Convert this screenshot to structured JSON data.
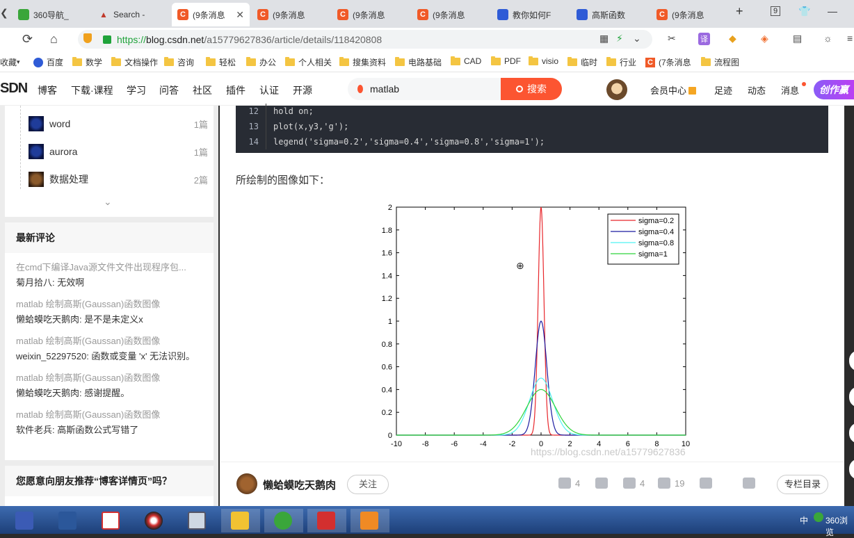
{
  "browser": {
    "tabs": [
      {
        "label": "360导航_",
        "icon": "360-icon"
      },
      {
        "label": "Search -",
        "icon": "matlab-icon"
      },
      {
        "label": "(9条消息",
        "icon": "csdn-icon",
        "active": true
      },
      {
        "label": "(9条消息",
        "icon": "csdn-icon"
      },
      {
        "label": "(9条消息",
        "icon": "csdn-icon"
      },
      {
        "label": "(9条消息",
        "icon": "csdn-icon"
      },
      {
        "label": "教你如何F",
        "icon": "baidu-paw-icon"
      },
      {
        "label": "高斯函数",
        "icon": "baidu-paw-icon"
      },
      {
        "label": "(9条消息",
        "icon": "csdn-icon"
      }
    ],
    "tab_close": "✕",
    "new_tab": "+",
    "tab_count": "9",
    "minimize": "—",
    "url": {
      "scheme": "https://",
      "host": "blog.csdn.net",
      "path": "/a15779627836/article/details/118420808"
    },
    "translate_badge": "译",
    "bookmarks": [
      {
        "label": "收藏",
        "type": "text"
      },
      {
        "label": "百度",
        "type": "baidu"
      },
      {
        "label": "数学",
        "type": "folder"
      },
      {
        "label": "文档操作",
        "type": "folder"
      },
      {
        "label": "咨询",
        "type": "folder"
      },
      {
        "label": "轻松",
        "type": "folder"
      },
      {
        "label": "办公",
        "type": "folder"
      },
      {
        "label": "个人相关",
        "type": "folder"
      },
      {
        "label": "搜集资料",
        "type": "folder"
      },
      {
        "label": "电路基础",
        "type": "folder"
      },
      {
        "label": "CAD",
        "type": "folder"
      },
      {
        "label": "PDF",
        "type": "folder"
      },
      {
        "label": "visio",
        "type": "folder"
      },
      {
        "label": "临时",
        "type": "folder"
      },
      {
        "label": "行业",
        "type": "folder"
      },
      {
        "label": "(7条消息",
        "type": "csdn"
      },
      {
        "label": "流程图",
        "type": "folder"
      }
    ]
  },
  "csdn": {
    "logo": "SDN",
    "nav": [
      "博客",
      "下载·课程",
      "学习",
      "问答",
      "社区",
      "插件",
      "认证",
      "开源"
    ],
    "search_value": "matlab",
    "search_button": "搜索",
    "right_nav": [
      "会员中心",
      "足迹",
      "动态",
      "消息"
    ],
    "create_label": "创作赢"
  },
  "sidebar": {
    "columns": [
      {
        "name": "word",
        "count": "1篇"
      },
      {
        "name": "aurora",
        "count": "1篇"
      },
      {
        "name": "数据处理",
        "count": "2篇"
      }
    ],
    "comments_title": "最新评论",
    "comments": [
      {
        "title": "在cmd下编译Java源文件文件出现程序包...",
        "text": "菊月拾八: 无效啊"
      },
      {
        "title": "matlab 绘制高斯(Gaussan)函数图像",
        "text": "懒蛤蟆吃天鹅肉: 是不是未定义x"
      },
      {
        "title": "matlab 绘制高斯(Gaussan)函数图像",
        "text": "weixin_52297520: 函数或变量 'x' 无法识别。"
      },
      {
        "title": "matlab 绘制高斯(Gaussan)函数图像",
        "text": "懒蛤蟆吃天鹅肉: 感谢提醒。"
      },
      {
        "title": "matlab 绘制高斯(Gaussan)函数图像",
        "text": "软件老兵: 高斯函数公式写错了"
      }
    ],
    "recommend_title": "您愿意向朋友推荐“博客详情页”吗？"
  },
  "article": {
    "code_lines": [
      {
        "num": "12",
        "code": "hold on;"
      },
      {
        "num": "13",
        "code": "plot(x,y3,'g');"
      },
      {
        "num": "14",
        "code": "legend('sigma=0.2','sigma=0.4','sigma=0.8','sigma=1');"
      }
    ],
    "caption": "所绘制的图像如下：",
    "watermark": "https://blog.csdn.net/a15779627836"
  },
  "chart_data": {
    "type": "line",
    "xlim": [
      -10,
      10
    ],
    "ylim": [
      0,
      2
    ],
    "xticks": [
      -10,
      -8,
      -6,
      -4,
      -2,
      0,
      2,
      4,
      6,
      8,
      10
    ],
    "yticks": [
      0,
      0.2,
      0.4,
      0.6,
      0.8,
      1,
      1.2,
      1.4,
      1.6,
      1.8,
      2
    ],
    "legend_position": "top-right",
    "series": [
      {
        "name": "sigma=0.2",
        "sigma": 0.2,
        "peak": 2.0,
        "color": "#e8262b"
      },
      {
        "name": "sigma=0.4",
        "sigma": 0.4,
        "peak": 1.0,
        "color": "#1a1aa0"
      },
      {
        "name": "sigma=0.8",
        "sigma": 0.8,
        "peak": 0.5,
        "color": "#4ff2f2"
      },
      {
        "name": "sigma=1",
        "sigma": 1.0,
        "peak": 0.4,
        "color": "#2fd33a"
      }
    ]
  },
  "author": {
    "name": "懒蛤蟆吃天鹅肉",
    "follow": "关注",
    "likes": "4",
    "comments": "4",
    "favorites": "19",
    "toc": "专栏目录"
  },
  "taskbar": {
    "ime": "中",
    "tray_app": "360浏览"
  }
}
